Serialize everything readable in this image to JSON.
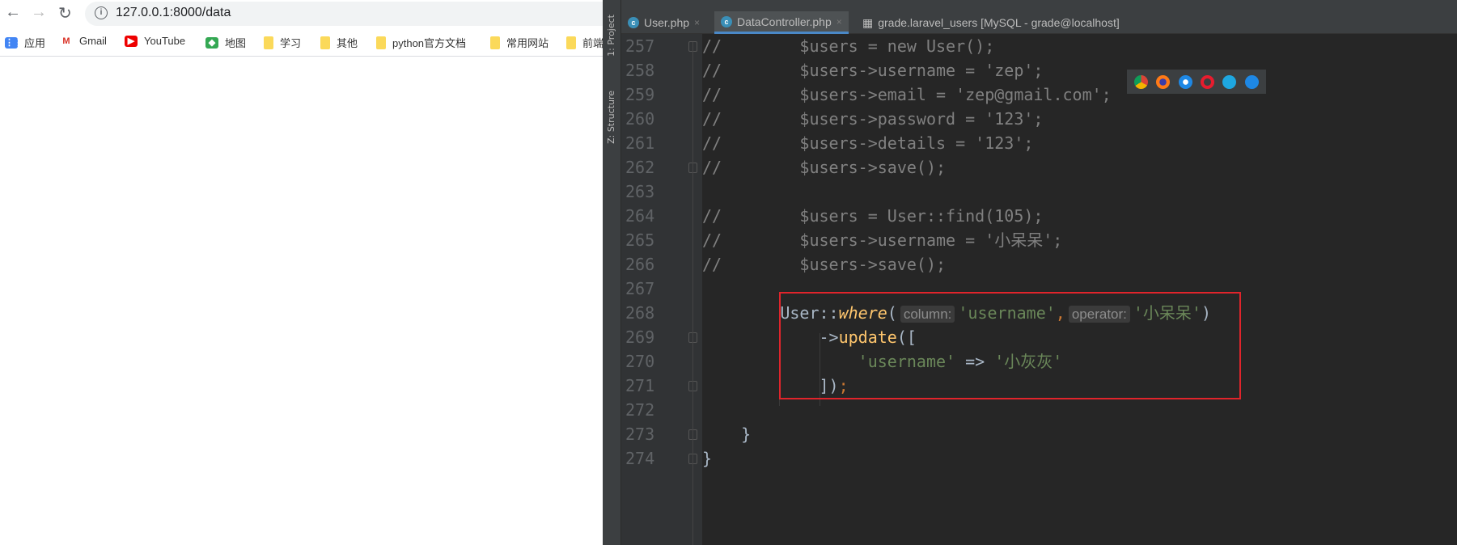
{
  "browser": {
    "url": "127.0.0.1:8000/data",
    "bookmarks": [
      {
        "label": "应用",
        "icon": "apps-grid-icon"
      },
      {
        "label": "Gmail",
        "icon": "gmail-icon"
      },
      {
        "label": "YouTube",
        "icon": "youtube-icon"
      },
      {
        "label": "地图",
        "icon": "maps-icon"
      },
      {
        "label": "学习",
        "icon": "folder-icon"
      },
      {
        "label": "其他",
        "icon": "folder-icon"
      },
      {
        "label": "python官方文档",
        "icon": "folder-icon"
      },
      {
        "label": "常用网站",
        "icon": "folder-icon"
      },
      {
        "label": "前端",
        "icon": "folder-icon"
      }
    ]
  },
  "ide": {
    "side_labels": [
      "1: Project",
      "Z: Structure"
    ],
    "tabs": [
      {
        "label": "User.php",
        "active": false
      },
      {
        "label": "DataController.php",
        "active": true
      },
      {
        "label": "grade.laravel_users [MySQL - grade@localhost]",
        "active": false
      }
    ],
    "lines": [
      {
        "n": "257",
        "tokens": [
          [
            "cm",
            "//        "
          ],
          [
            "cm",
            "$users = new User();"
          ]
        ]
      },
      {
        "n": "258",
        "tokens": [
          [
            "cm",
            "//        $users->username = 'zep';"
          ]
        ]
      },
      {
        "n": "259",
        "tokens": [
          [
            "cm",
            "//        $users->email = 'zep@gmail.com';"
          ]
        ]
      },
      {
        "n": "260",
        "tokens": [
          [
            "cm",
            "//        $users->password = '123';"
          ]
        ]
      },
      {
        "n": "261",
        "tokens": [
          [
            "cm",
            "//        $users->details = '123';"
          ]
        ]
      },
      {
        "n": "262",
        "tokens": [
          [
            "cm",
            "//        $users->save();"
          ]
        ]
      },
      {
        "n": "263",
        "tokens": []
      },
      {
        "n": "264",
        "tokens": [
          [
            "cm",
            "//        $users = User::find(105);"
          ]
        ]
      },
      {
        "n": "265",
        "tokens": [
          [
            "cm",
            "//        $users->username = '小呆呆';"
          ]
        ]
      },
      {
        "n": "266",
        "tokens": [
          [
            "cm",
            "//        $users->save();"
          ]
        ]
      },
      {
        "n": "267",
        "tokens": []
      },
      {
        "n": "268",
        "tokens": [
          [
            "id",
            "        User::"
          ],
          [
            "it",
            "where"
          ],
          [
            "br",
            "("
          ],
          [
            "hint",
            "column:"
          ],
          [
            "st",
            "'username'"
          ],
          [
            "pu",
            ","
          ],
          [
            "hint",
            "operator:"
          ],
          [
            "st",
            "'小呆呆'"
          ],
          [
            "br",
            ")"
          ]
        ]
      },
      {
        "n": "269",
        "tokens": [
          [
            "id",
            "            ->"
          ],
          [
            "fn",
            "update"
          ],
          [
            "br",
            "(["
          ]
        ]
      },
      {
        "n": "270",
        "tokens": [
          [
            "id",
            "                "
          ],
          [
            "st",
            "'username'"
          ],
          [
            "id",
            " => "
          ],
          [
            "st",
            "'小灰灰'"
          ]
        ]
      },
      {
        "n": "271",
        "tokens": [
          [
            "id",
            "            ])"
          ],
          [
            "pu",
            ";"
          ]
        ]
      },
      {
        "n": "272",
        "tokens": []
      },
      {
        "n": "273",
        "tokens": [
          [
            "id",
            "    }"
          ]
        ]
      },
      {
        "n": "274",
        "tokens": [
          [
            "id",
            "}"
          ]
        ]
      }
    ],
    "folds": [
      "257",
      "262",
      "269",
      "271",
      "273",
      "274"
    ],
    "browser_icons": [
      "chrome-icon",
      "firefox-icon",
      "safari-icon",
      "opera-icon",
      "ie-icon",
      "edge-icon"
    ],
    "highlight_color": "#e0242b"
  }
}
